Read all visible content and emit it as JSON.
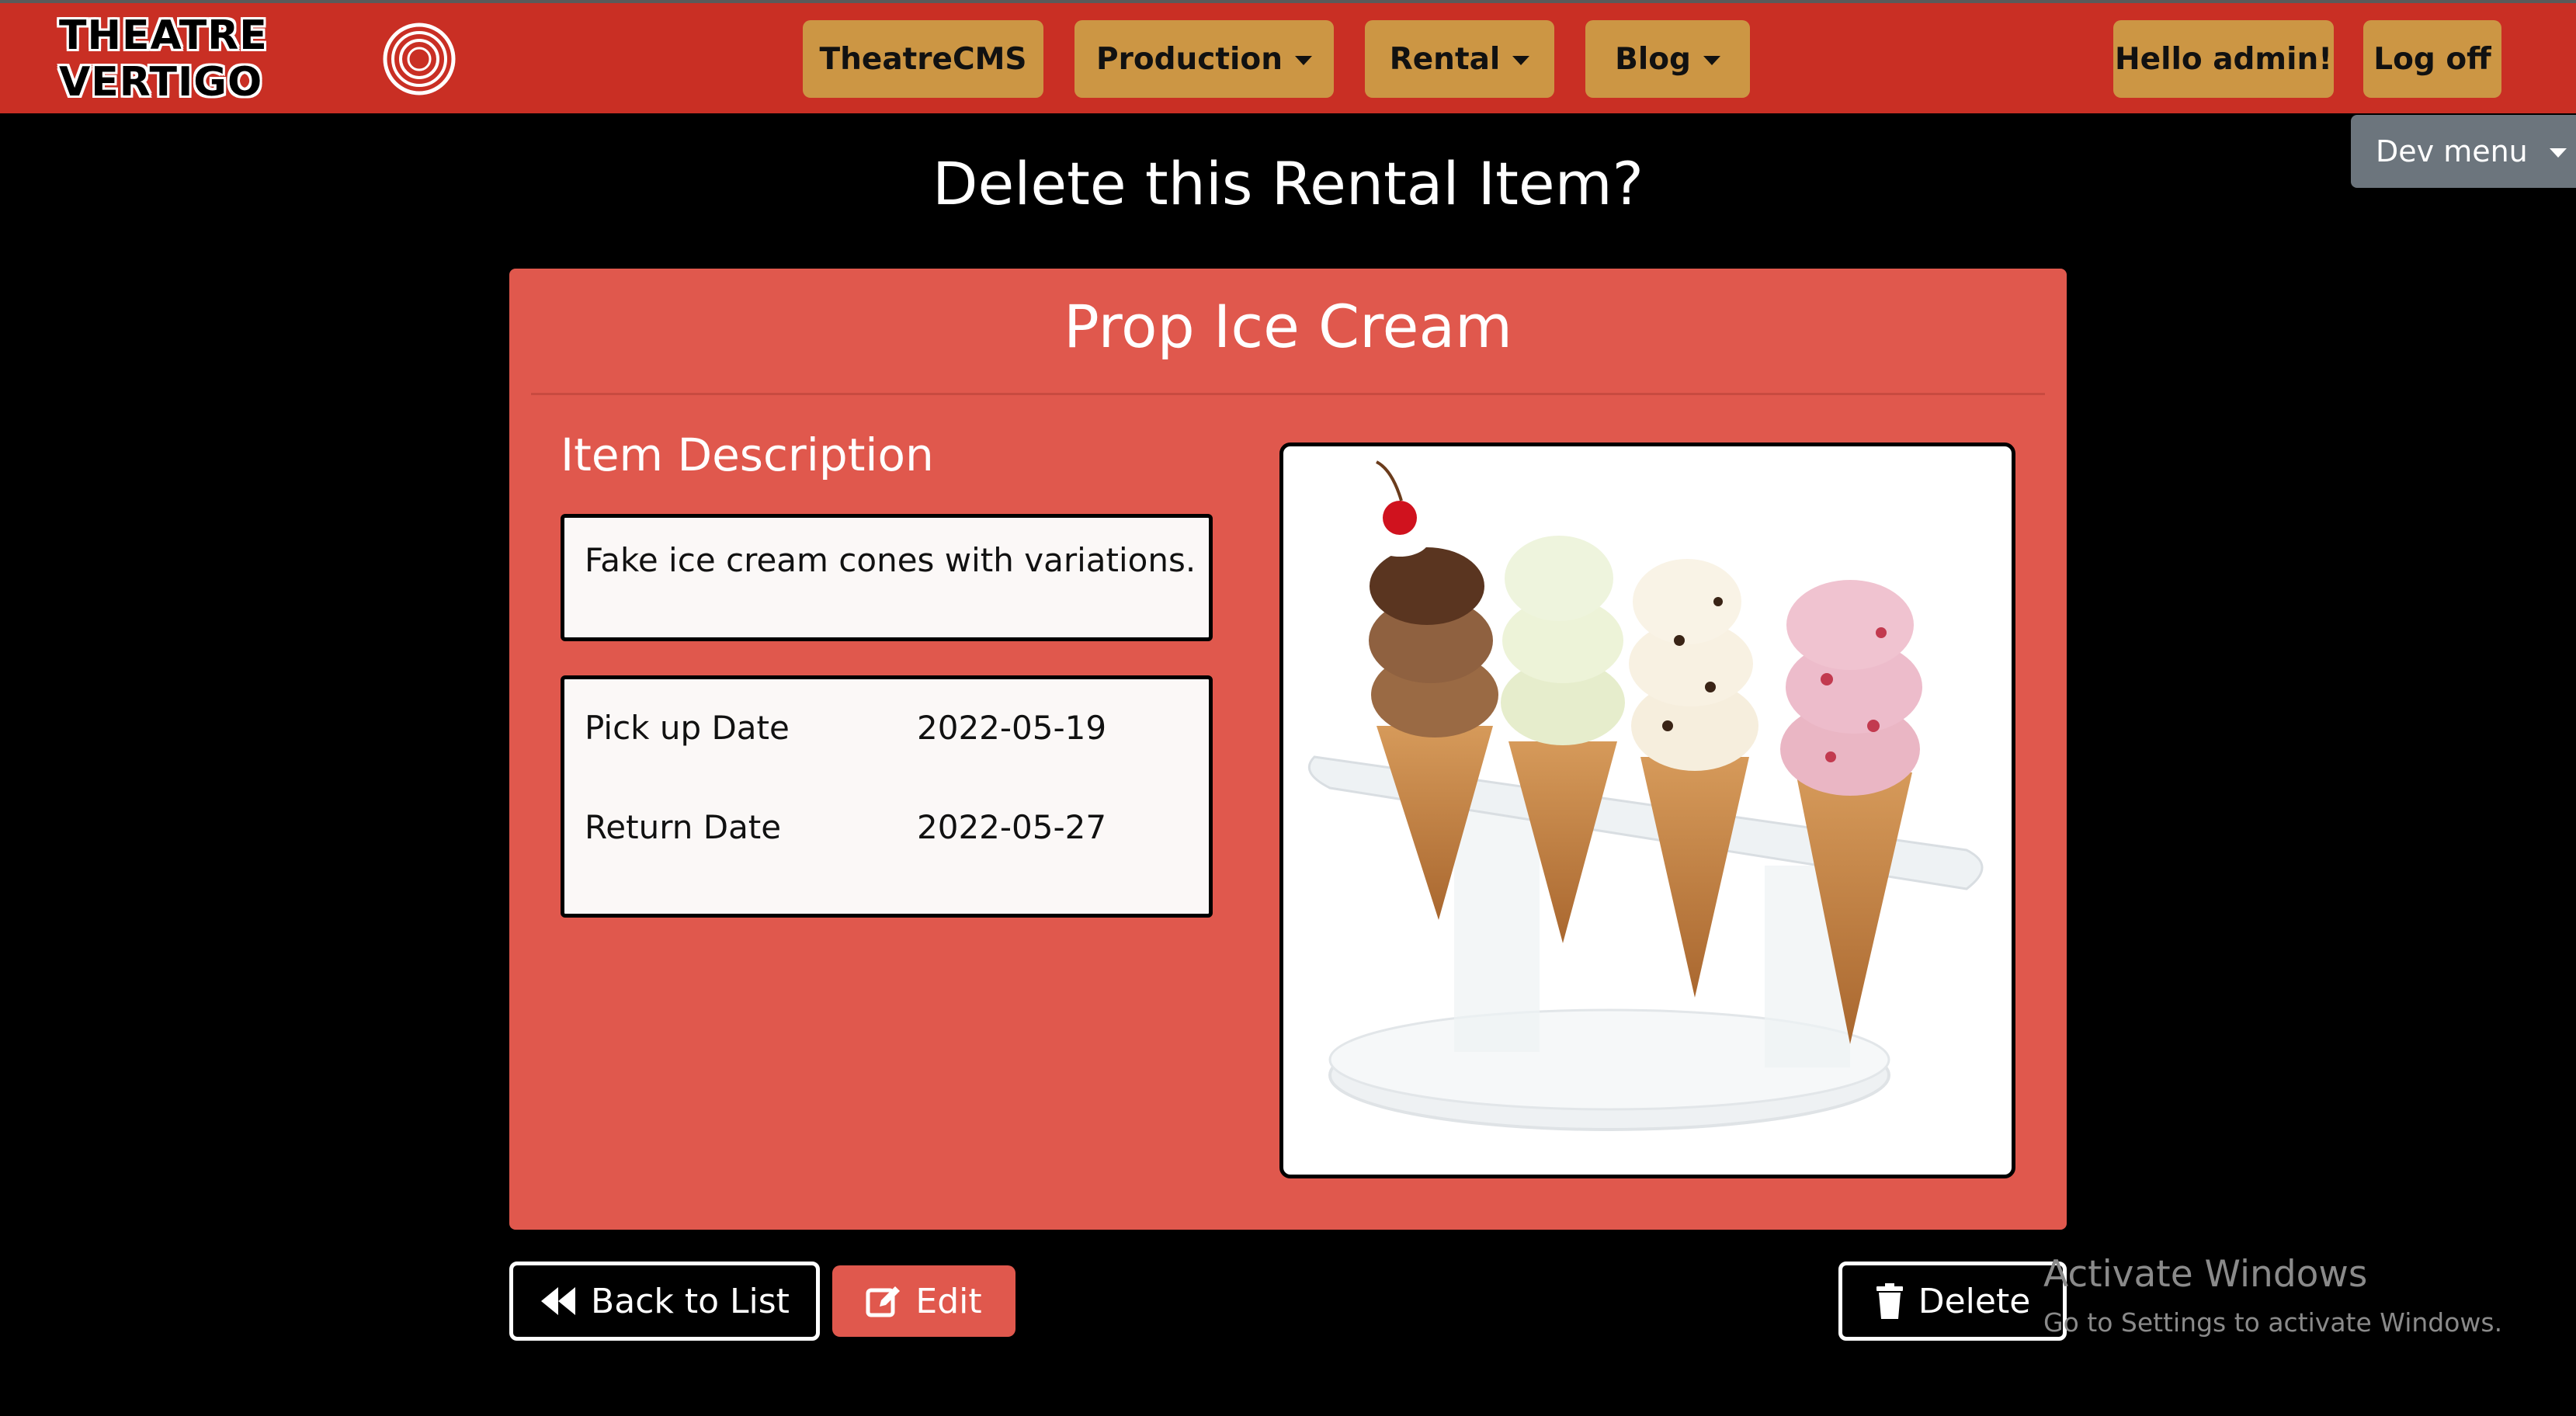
{
  "navbar": {
    "logo_text": "THEATRE VERTIGO",
    "items": [
      {
        "label": "TheatreCMS",
        "dropdown": false
      },
      {
        "label": "Production",
        "dropdown": true
      },
      {
        "label": "Rental",
        "dropdown": true
      },
      {
        "label": "Blog",
        "dropdown": true
      }
    ],
    "greeting": "Hello admin!",
    "logoff": "Log off",
    "dev_menu": "Dev menu"
  },
  "page": {
    "title": "Delete this Rental Item?"
  },
  "item": {
    "name": "Prop Ice Cream",
    "description_heading": "Item Description",
    "description": "Fake ice cream cones with variations.",
    "pickup_label": "Pick up Date",
    "pickup_date": "2022-05-19",
    "return_label": "Return Date",
    "return_date": "2022-05-27"
  },
  "actions": {
    "back": "Back to List",
    "edit": "Edit",
    "delete": "Delete"
  },
  "watermark": {
    "title": "Activate Windows",
    "subtitle": "Go to Settings to activate Windows."
  },
  "colors": {
    "navbar": "#c92f24",
    "nav_button": "#cc9644",
    "card": "#e0584d",
    "background": "#000000"
  }
}
